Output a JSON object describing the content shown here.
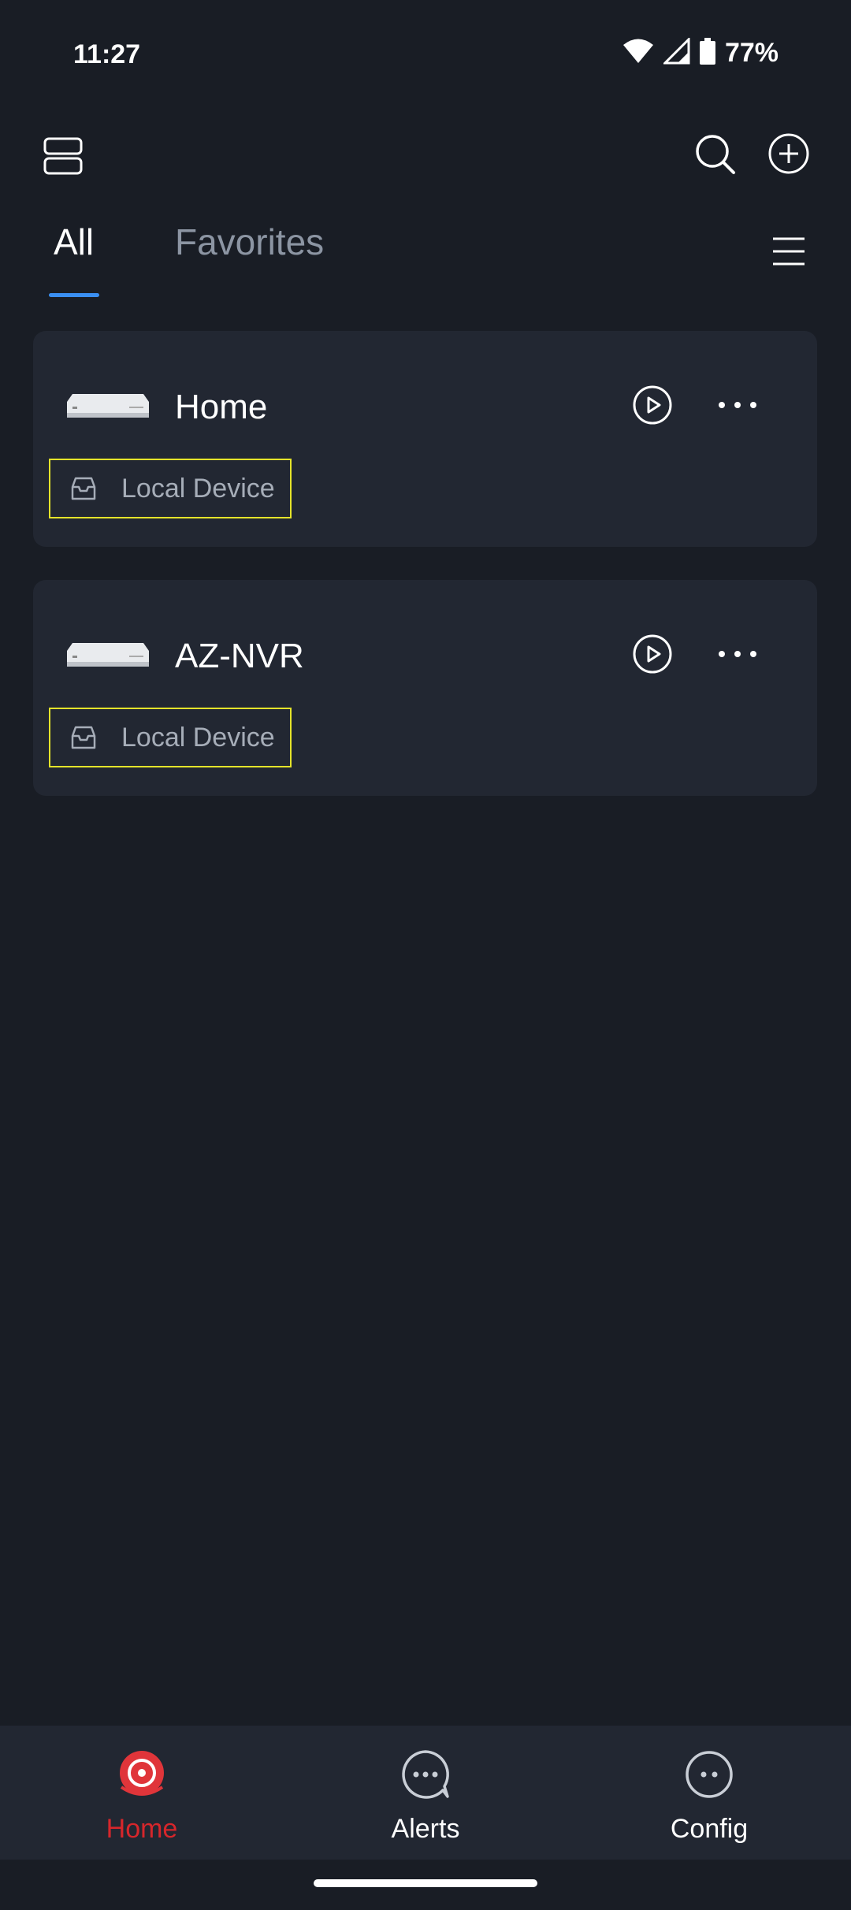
{
  "status_bar": {
    "time": "11:27",
    "battery_percent": "77%",
    "wifi_icon": "wifi-icon",
    "signal_icon": "cellular-signal-icon",
    "battery_icon": "battery-icon"
  },
  "top_bar": {
    "layout_icon": "device-list-layout-icon",
    "search_icon": "search-icon",
    "add_icon": "add-circle-icon"
  },
  "tabs": [
    {
      "label": "All",
      "active": true
    },
    {
      "label": "Favorites",
      "active": false
    }
  ],
  "devices": [
    {
      "name": "Home",
      "tag": "Local Device"
    },
    {
      "name": "AZ-NVR",
      "tag": "Local Device"
    }
  ],
  "bottom_nav": [
    {
      "label": "Home",
      "icon": "camera-home-icon",
      "active": true
    },
    {
      "label": "Alerts",
      "icon": "chat-bubble-icon",
      "active": false
    },
    {
      "label": "Config",
      "icon": "robot-face-icon",
      "active": false
    }
  ],
  "colors": {
    "background": "#191d25",
    "card": "#222732",
    "accent_blue": "#3a8ff2",
    "active_red": "#d6262b",
    "highlight_yellow": "#e4e32a"
  }
}
